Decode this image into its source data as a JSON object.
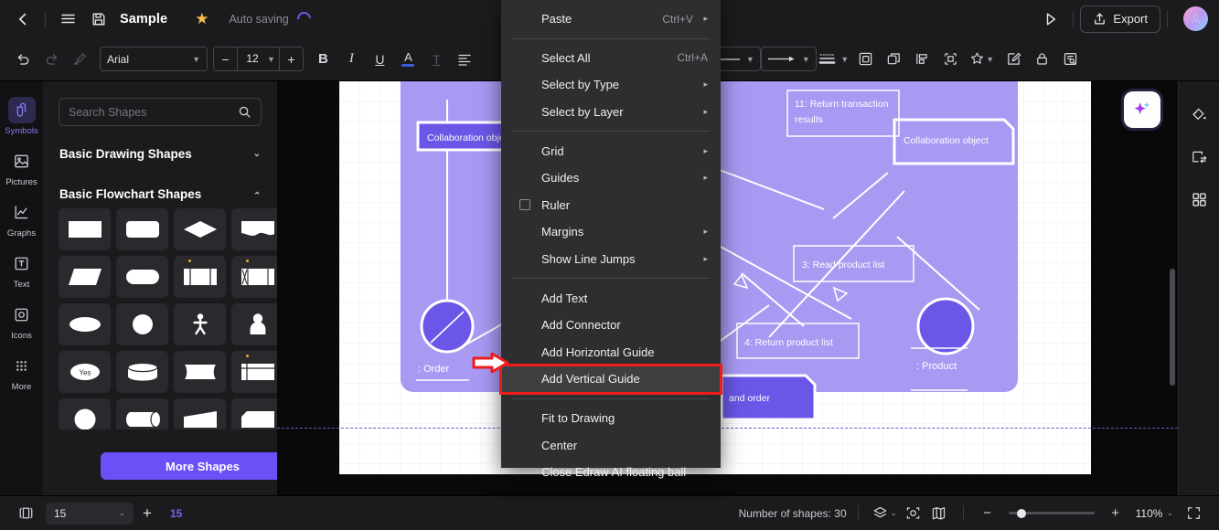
{
  "titlebar": {
    "back_icon": "chevron-left-icon",
    "menu_icon": "hamburger-menu-icon",
    "save_icon": "floppy-disk-icon",
    "doc_title": "Sample",
    "star_icon": "star-icon",
    "autosave_text": "Auto saving",
    "spinner_icon": "loading-spinner-icon",
    "present_icon": "play-triangle-icon",
    "export_label": "Export",
    "export_icon": "upload-icon",
    "avatar_icon": "user-avatar-icon"
  },
  "toolbar": {
    "undo_icon": "undo-icon",
    "redo_icon": "redo-icon",
    "format_painter_icon": "format-painter-icon",
    "font_family": "Arial",
    "font_size": "12",
    "decrease_label": "−",
    "increase_label": "+",
    "bold_label": "B",
    "italic_label": "I",
    "underline_label": "U",
    "font_color_label": "A",
    "strikethrough_label": "T",
    "align_icon": "align-left-icon",
    "line_style_icon": "line-style-icon",
    "arrow_style_icon": "arrow-end-icon",
    "line_weight_icon": "line-weight-icon",
    "bring_front_icon": "bring-to-front-icon",
    "send_back_icon": "send-to-back-icon",
    "align_objects_icon": "align-objects-icon",
    "group_icon": "group-icon",
    "effects_icon": "effects-star-icon",
    "edit_icon": "edit-pencil-icon",
    "lock_icon": "lock-icon",
    "find_icon": "find-replace-icon"
  },
  "rail": {
    "items": [
      {
        "label": "Symbols",
        "icon": "symbols-icon",
        "active": true
      },
      {
        "label": "Pictures",
        "icon": "pictures-icon",
        "active": false
      },
      {
        "label": "Graphs",
        "icon": "graphs-icon",
        "active": false
      },
      {
        "label": "Text",
        "icon": "text-icon",
        "active": false
      },
      {
        "label": "Icons",
        "icon": "icons-icon",
        "active": false
      },
      {
        "label": "More",
        "icon": "more-grid-icon",
        "active": false
      }
    ]
  },
  "panel": {
    "search_placeholder": "Search Shapes",
    "search_value": "",
    "search_icon": "search-icon",
    "sections": [
      {
        "title": "Basic Drawing Shapes",
        "chevron": "chevron-down-icon",
        "expanded": false
      },
      {
        "title": "Basic Flowchart Shapes",
        "chevron": "chevron-up-icon",
        "expanded": true
      }
    ],
    "shapes": [
      {
        "name": "rectangle"
      },
      {
        "name": "rounded-rectangle"
      },
      {
        "name": "diamond"
      },
      {
        "name": "document-wave"
      },
      {
        "name": "parallelogram"
      },
      {
        "name": "stadium"
      },
      {
        "name": "predefined-process",
        "dot": true
      },
      {
        "name": "internal-storage",
        "dot": true
      },
      {
        "name": "ellipse"
      },
      {
        "name": "circle"
      },
      {
        "name": "actor-stick-figure"
      },
      {
        "name": "person-bust"
      },
      {
        "name": "decision-yes",
        "label": "Yes"
      },
      {
        "name": "cylinder-database"
      },
      {
        "name": "tape-data"
      },
      {
        "name": "card-deck",
        "dot": true
      },
      {
        "name": "circle-plain"
      },
      {
        "name": "direct-access-storage"
      },
      {
        "name": "trapezoid-flat"
      },
      {
        "name": "cut-corner-box"
      }
    ],
    "more_shapes_label": "More Shapes"
  },
  "context_menu": {
    "items": [
      {
        "label": "Paste",
        "shortcut": "Ctrl+V",
        "submenu": true,
        "checkbox": false,
        "highlighted": false
      },
      {
        "divider": true
      },
      {
        "label": "Select All",
        "shortcut": "Ctrl+A",
        "submenu": false,
        "checkbox": false,
        "highlighted": false
      },
      {
        "label": "Select by Type",
        "shortcut": "",
        "submenu": true,
        "checkbox": false,
        "highlighted": false
      },
      {
        "label": "Select by Layer",
        "shortcut": "",
        "submenu": true,
        "checkbox": false,
        "highlighted": false
      },
      {
        "divider": true
      },
      {
        "label": "Grid",
        "shortcut": "",
        "submenu": true,
        "checkbox": false,
        "highlighted": false
      },
      {
        "label": "Guides",
        "shortcut": "",
        "submenu": true,
        "checkbox": false,
        "highlighted": false
      },
      {
        "label": "Ruler",
        "shortcut": "",
        "submenu": false,
        "checkbox": true,
        "highlighted": false
      },
      {
        "label": "Margins",
        "shortcut": "",
        "submenu": true,
        "checkbox": false,
        "highlighted": false
      },
      {
        "label": "Show Line Jumps",
        "shortcut": "",
        "submenu": true,
        "checkbox": false,
        "highlighted": false
      },
      {
        "divider": true
      },
      {
        "label": "Add Text",
        "shortcut": "",
        "submenu": false,
        "checkbox": false,
        "highlighted": false
      },
      {
        "label": "Add Connector",
        "shortcut": "",
        "submenu": false,
        "checkbox": false,
        "highlighted": false
      },
      {
        "label": "Add Horizontal Guide",
        "shortcut": "",
        "submenu": false,
        "checkbox": false,
        "highlighted": false
      },
      {
        "label": "Add Vertical Guide",
        "shortcut": "",
        "submenu": false,
        "checkbox": false,
        "highlighted": true
      },
      {
        "divider": true
      },
      {
        "label": "Fit to Drawing",
        "shortcut": "",
        "submenu": false,
        "checkbox": false,
        "highlighted": false
      },
      {
        "label": "Center",
        "shortcut": "",
        "submenu": false,
        "checkbox": false,
        "highlighted": false
      },
      {
        "label": "Close Edraw AI floating ball",
        "shortcut": "",
        "submenu": false,
        "checkbox": false,
        "highlighted": false
      }
    ],
    "highlight_color": "#ee1d1d"
  },
  "canvas": {
    "ai_ball_icon": "ai-sparkle-icon",
    "lane_color": "#a899f2",
    "node_color": "#6a57e8",
    "diagram_labels": [
      {
        "text": "Collaboration object",
        "type": "note"
      },
      {
        "text": "11: Return transaction results",
        "type": "message"
      },
      {
        "text": "Collaboration object",
        "type": "note"
      },
      {
        "text": "3: Read product list",
        "type": "message"
      },
      {
        "text": "4: Return product list",
        "type": "message"
      },
      {
        "text": "and order",
        "type": "note"
      },
      {
        "text": ": Order",
        "type": "object"
      },
      {
        "text": ": Product",
        "type": "object"
      }
    ]
  },
  "right_rail": {
    "items": [
      {
        "icon": "fill-paint-icon",
        "name": "fill-tool"
      },
      {
        "icon": "layout-swap-icon",
        "name": "layout-tool"
      },
      {
        "icon": "grid-panel-icon",
        "name": "panels-tool"
      }
    ]
  },
  "status": {
    "page_manager_icon": "page-manager-icon",
    "page_value": "15",
    "page_chevron": "chevron-down-icon",
    "add_page_label": "+",
    "current_page": "15",
    "shapes_count_label": "Number of shapes: 30",
    "layers_icon": "layers-icon",
    "focus_icon": "focus-icon",
    "map_icon": "map-overview-icon",
    "zoom_minus": "−",
    "zoom_plus": "+",
    "zoom_level": "110%",
    "zoom_chevron": "chevron-down-icon",
    "fullscreen_icon": "fullscreen-icon"
  }
}
